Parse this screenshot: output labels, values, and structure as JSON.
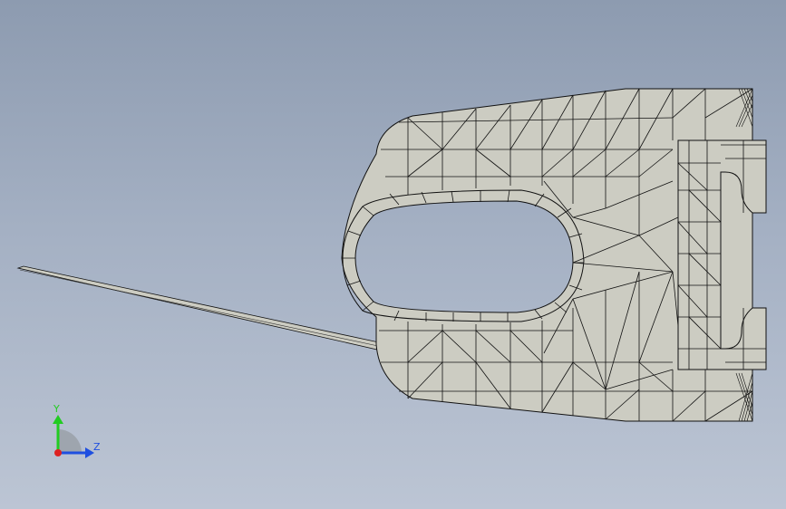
{
  "viewport": {
    "model_fill": "#ccccc2",
    "edge_color": "#111111",
    "background_top": "#8d9bb0",
    "background_bottom": "#bcc5d4"
  },
  "triad": {
    "y_label": "Y",
    "z_label": "Z",
    "y_color": "#22cc22",
    "z_color": "#1f4fe0",
    "x_color": "#dd2222"
  }
}
